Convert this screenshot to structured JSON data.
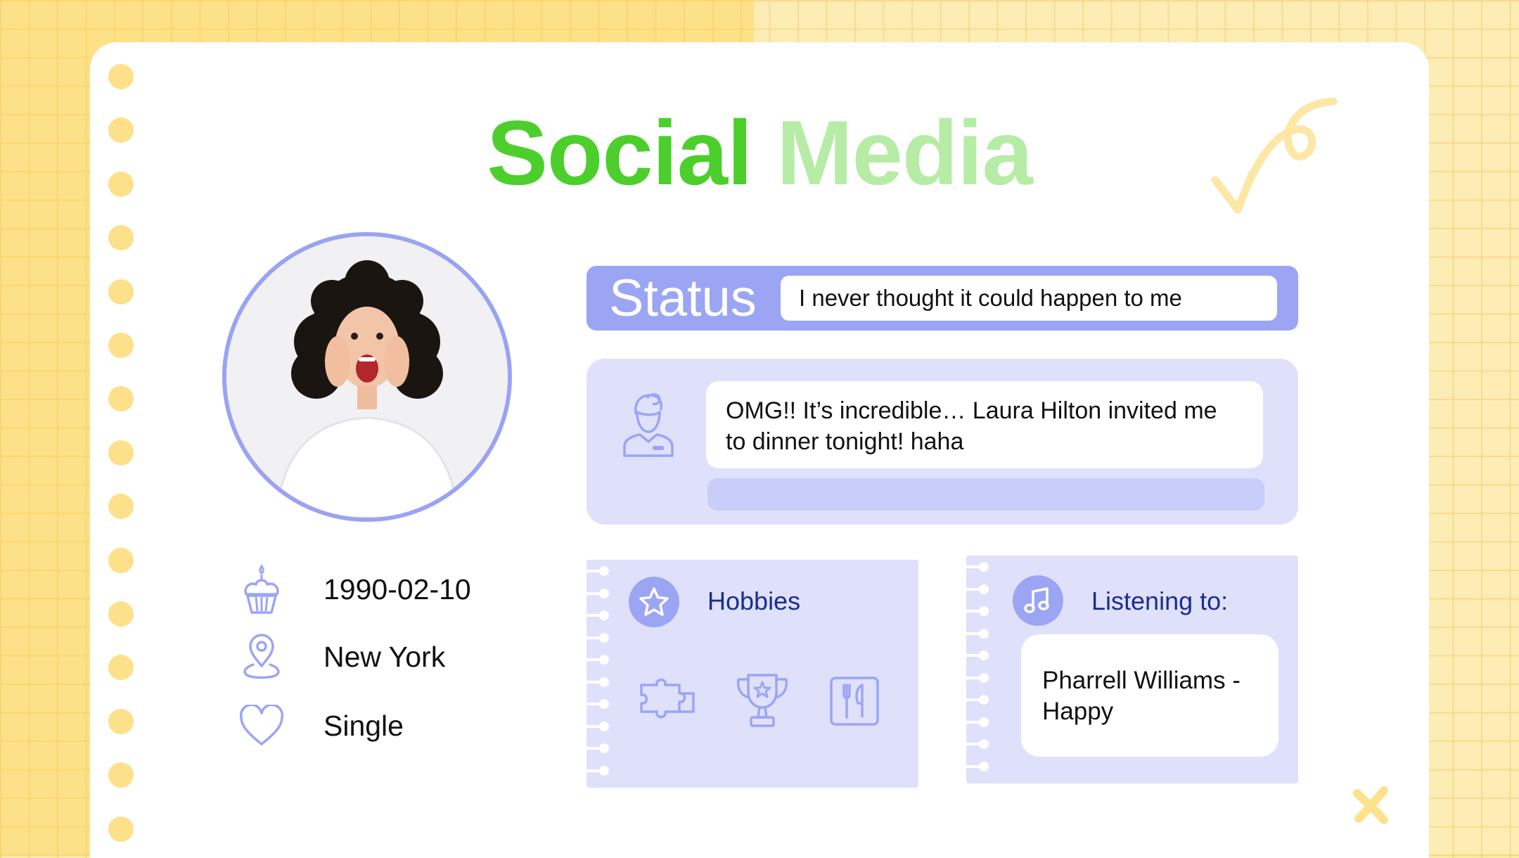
{
  "title": {
    "word1": "Social",
    "word2": "Media"
  },
  "profile": {
    "birthday": "1990-02-10",
    "location": "New York",
    "relationship": "Single",
    "icons": {
      "birthday": "cupcake-icon",
      "location": "location-pin-icon",
      "relationship": "heart-icon"
    }
  },
  "status": {
    "label": "Status",
    "text": "I never thought it could happen to me"
  },
  "post": {
    "text": "OMG!! It’s incredible… Laura Hilton invited me to dinner tonight! haha",
    "icon": "user-icon"
  },
  "hobbies": {
    "title": "Hobbies",
    "icons": [
      "puzzle-icon",
      "trophy-icon",
      "cutlery-icon"
    ]
  },
  "listening": {
    "title": "Listening to:",
    "song": "Pharrell Williams - Happy",
    "icon": "music-note-icon"
  },
  "colors": {
    "title_green": "#4ccf2c",
    "title_light_green": "#b6eca6",
    "accent_purple": "#9ba5f4",
    "panel_lavender": "#dfe1fb",
    "text_navy": "#1d2c8f",
    "background_yellow": "#fde9a6"
  }
}
